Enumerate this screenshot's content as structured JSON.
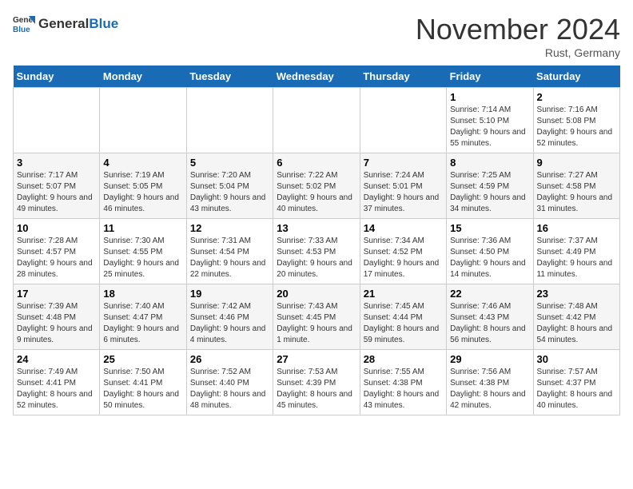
{
  "header": {
    "logo_general": "General",
    "logo_blue": "Blue",
    "month_title": "November 2024",
    "subtitle": "Rust, Germany"
  },
  "weekdays": [
    "Sunday",
    "Monday",
    "Tuesday",
    "Wednesday",
    "Thursday",
    "Friday",
    "Saturday"
  ],
  "weeks": [
    [
      {
        "day": "",
        "info": ""
      },
      {
        "day": "",
        "info": ""
      },
      {
        "day": "",
        "info": ""
      },
      {
        "day": "",
        "info": ""
      },
      {
        "day": "",
        "info": ""
      },
      {
        "day": "1",
        "info": "Sunrise: 7:14 AM\nSunset: 5:10 PM\nDaylight: 9 hours and 55 minutes."
      },
      {
        "day": "2",
        "info": "Sunrise: 7:16 AM\nSunset: 5:08 PM\nDaylight: 9 hours and 52 minutes."
      }
    ],
    [
      {
        "day": "3",
        "info": "Sunrise: 7:17 AM\nSunset: 5:07 PM\nDaylight: 9 hours and 49 minutes."
      },
      {
        "day": "4",
        "info": "Sunrise: 7:19 AM\nSunset: 5:05 PM\nDaylight: 9 hours and 46 minutes."
      },
      {
        "day": "5",
        "info": "Sunrise: 7:20 AM\nSunset: 5:04 PM\nDaylight: 9 hours and 43 minutes."
      },
      {
        "day": "6",
        "info": "Sunrise: 7:22 AM\nSunset: 5:02 PM\nDaylight: 9 hours and 40 minutes."
      },
      {
        "day": "7",
        "info": "Sunrise: 7:24 AM\nSunset: 5:01 PM\nDaylight: 9 hours and 37 minutes."
      },
      {
        "day": "8",
        "info": "Sunrise: 7:25 AM\nSunset: 4:59 PM\nDaylight: 9 hours and 34 minutes."
      },
      {
        "day": "9",
        "info": "Sunrise: 7:27 AM\nSunset: 4:58 PM\nDaylight: 9 hours and 31 minutes."
      }
    ],
    [
      {
        "day": "10",
        "info": "Sunrise: 7:28 AM\nSunset: 4:57 PM\nDaylight: 9 hours and 28 minutes."
      },
      {
        "day": "11",
        "info": "Sunrise: 7:30 AM\nSunset: 4:55 PM\nDaylight: 9 hours and 25 minutes."
      },
      {
        "day": "12",
        "info": "Sunrise: 7:31 AM\nSunset: 4:54 PM\nDaylight: 9 hours and 22 minutes."
      },
      {
        "day": "13",
        "info": "Sunrise: 7:33 AM\nSunset: 4:53 PM\nDaylight: 9 hours and 20 minutes."
      },
      {
        "day": "14",
        "info": "Sunrise: 7:34 AM\nSunset: 4:52 PM\nDaylight: 9 hours and 17 minutes."
      },
      {
        "day": "15",
        "info": "Sunrise: 7:36 AM\nSunset: 4:50 PM\nDaylight: 9 hours and 14 minutes."
      },
      {
        "day": "16",
        "info": "Sunrise: 7:37 AM\nSunset: 4:49 PM\nDaylight: 9 hours and 11 minutes."
      }
    ],
    [
      {
        "day": "17",
        "info": "Sunrise: 7:39 AM\nSunset: 4:48 PM\nDaylight: 9 hours and 9 minutes."
      },
      {
        "day": "18",
        "info": "Sunrise: 7:40 AM\nSunset: 4:47 PM\nDaylight: 9 hours and 6 minutes."
      },
      {
        "day": "19",
        "info": "Sunrise: 7:42 AM\nSunset: 4:46 PM\nDaylight: 9 hours and 4 minutes."
      },
      {
        "day": "20",
        "info": "Sunrise: 7:43 AM\nSunset: 4:45 PM\nDaylight: 9 hours and 1 minute."
      },
      {
        "day": "21",
        "info": "Sunrise: 7:45 AM\nSunset: 4:44 PM\nDaylight: 8 hours and 59 minutes."
      },
      {
        "day": "22",
        "info": "Sunrise: 7:46 AM\nSunset: 4:43 PM\nDaylight: 8 hours and 56 minutes."
      },
      {
        "day": "23",
        "info": "Sunrise: 7:48 AM\nSunset: 4:42 PM\nDaylight: 8 hours and 54 minutes."
      }
    ],
    [
      {
        "day": "24",
        "info": "Sunrise: 7:49 AM\nSunset: 4:41 PM\nDaylight: 8 hours and 52 minutes."
      },
      {
        "day": "25",
        "info": "Sunrise: 7:50 AM\nSunset: 4:41 PM\nDaylight: 8 hours and 50 minutes."
      },
      {
        "day": "26",
        "info": "Sunrise: 7:52 AM\nSunset: 4:40 PM\nDaylight: 8 hours and 48 minutes."
      },
      {
        "day": "27",
        "info": "Sunrise: 7:53 AM\nSunset: 4:39 PM\nDaylight: 8 hours and 45 minutes."
      },
      {
        "day": "28",
        "info": "Sunrise: 7:55 AM\nSunset: 4:38 PM\nDaylight: 8 hours and 43 minutes."
      },
      {
        "day": "29",
        "info": "Sunrise: 7:56 AM\nSunset: 4:38 PM\nDaylight: 8 hours and 42 minutes."
      },
      {
        "day": "30",
        "info": "Sunrise: 7:57 AM\nSunset: 4:37 PM\nDaylight: 8 hours and 40 minutes."
      }
    ]
  ]
}
